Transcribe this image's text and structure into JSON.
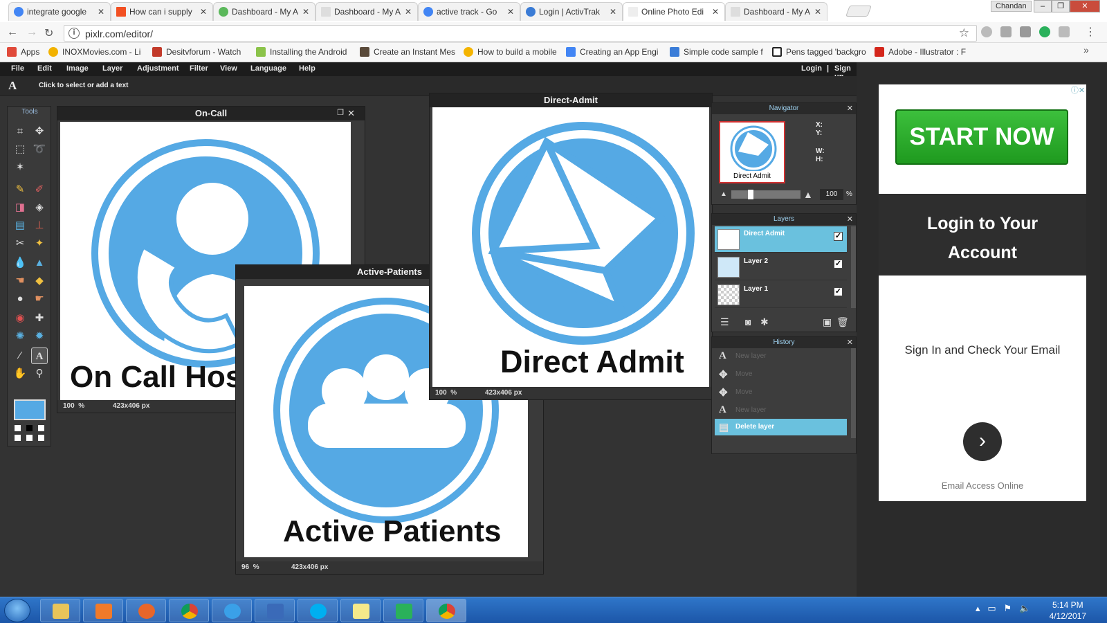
{
  "browser": {
    "tabs": [
      {
        "title": "integrate google",
        "icon": "google-icon",
        "active": false
      },
      {
        "title": "How can i supply",
        "icon": "microsoft-icon",
        "active": false
      },
      {
        "title": "Dashboard - My A",
        "icon": "dashboard-icon",
        "active": false
      },
      {
        "title": "Dashboard - My A",
        "icon": "page-icon",
        "active": false
      },
      {
        "title": "active track - Go",
        "icon": "google-icon",
        "active": false
      },
      {
        "title": "Login | ActivTrak",
        "icon": "activtrak-icon",
        "active": false
      },
      {
        "title": "Online Photo Edi",
        "icon": "page-icon",
        "active": true
      },
      {
        "title": "Dashboard - My A",
        "icon": "page-icon",
        "active": false
      }
    ],
    "window_user": "Chandan",
    "url": "pixlr.com/editor/",
    "bookmarks": [
      {
        "label": "Apps",
        "color": "#e04a3a"
      },
      {
        "label": "INOXMovies.com - Li",
        "color": "#f2b200"
      },
      {
        "label": "Desitvforum - Watch",
        "color": "#c23a2a"
      },
      {
        "label": "Installing the Android",
        "color": "#8bc34a"
      },
      {
        "label": "Create an Instant Mes",
        "color": "#5a4a3a"
      },
      {
        "label": "How to build a mobile",
        "color": "#f4b400"
      },
      {
        "label": "Creating an App Engi",
        "color": "#4285f4"
      },
      {
        "label": "Simple code sample f",
        "color": "#3b7dd8"
      },
      {
        "label": "Pens tagged 'backgro",
        "color": "#222222"
      },
      {
        "label": "Adobe - Illustrator : F",
        "color": "#d4261b"
      }
    ]
  },
  "editor": {
    "menu": [
      "File",
      "Edit",
      "Image",
      "Layer",
      "Adjustment",
      "Filter",
      "View",
      "Language",
      "Help"
    ],
    "login": "Login",
    "separator": "|",
    "signup": "Sign up",
    "options_hint": "Click to select or add a text",
    "tools_title": "Tools",
    "foreground_color": "#55a9e4",
    "windows": {
      "oncall": {
        "title": "On-Call",
        "caption": "On Call Hos",
        "zoom": "100",
        "zoom_unit": "%",
        "dims": "423x406 px"
      },
      "active": {
        "title": "Active-Patients",
        "caption": "Active Patients",
        "zoom": "96",
        "zoom_unit": "%",
        "dims": "423x406 px"
      },
      "direct": {
        "title": "Direct-Admit",
        "caption": "Direct Admit",
        "zoom": "100",
        "zoom_unit": "%",
        "dims": "423x406 px"
      }
    },
    "navigator": {
      "title": "Navigator",
      "thumb_caption": "Direct Admit",
      "x_label": "X:",
      "y_label": "Y:",
      "w_label": "W:",
      "h_label": "H:",
      "zoom": "100",
      "zoom_unit": "%"
    },
    "layers": {
      "title": "Layers",
      "items": [
        {
          "name": "Direct Admit",
          "selected": true,
          "visible_check": "✓"
        },
        {
          "name": "Layer 2",
          "selected": false,
          "visible_check": "✓"
        },
        {
          "name": "Layer 1",
          "selected": false,
          "visible_check": "✓"
        }
      ]
    },
    "history": {
      "title": "History",
      "items": [
        {
          "label": "New layer",
          "icon": "text-icon"
        },
        {
          "label": "Move",
          "icon": "move-icon"
        },
        {
          "label": "Move",
          "icon": "move-icon"
        },
        {
          "label": "New layer",
          "icon": "text-icon"
        },
        {
          "label": "Delete layer",
          "icon": "delete-layer-icon",
          "selected": true
        }
      ]
    }
  },
  "ad": {
    "start": "START NOW",
    "login_line1": "Login to Your",
    "login_line2": "Account",
    "signin": "Sign In and Check Your Email",
    "email_access": "Email Access Online",
    "brand_color": "#2aa52a"
  },
  "taskbar": {
    "time": "5:14 PM",
    "date": "4/12/2017"
  }
}
